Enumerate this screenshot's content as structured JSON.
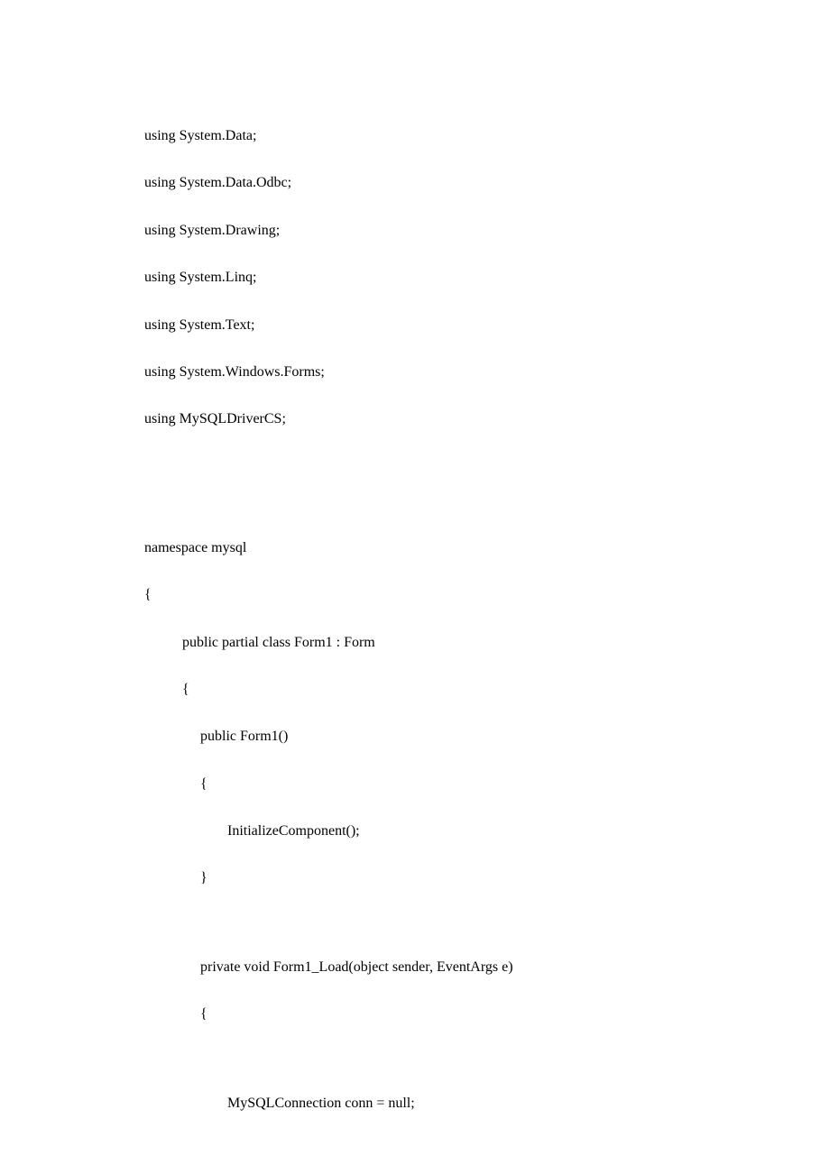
{
  "code": {
    "line1": "using System.Data;",
    "line2": "using System.Data.Odbc;",
    "line3": "using System.Drawing;",
    "line4": "using System.Linq;",
    "line5": "using System.Text;",
    "line6": "using System.Windows.Forms;",
    "line7": "using MySQLDriverCS;",
    "line8": "namespace mysql",
    "line9": "{",
    "line10": "public partial class Form1 : Form",
    "line11": "{",
    "line12": "public Form1()",
    "line13": "{",
    "line14": "InitializeComponent();",
    "line15": "}",
    "line16": "private void Form1_Load(object sender, EventArgs e)",
    "line17": "{",
    "line18": "MySQLConnection conn = null;"
  }
}
